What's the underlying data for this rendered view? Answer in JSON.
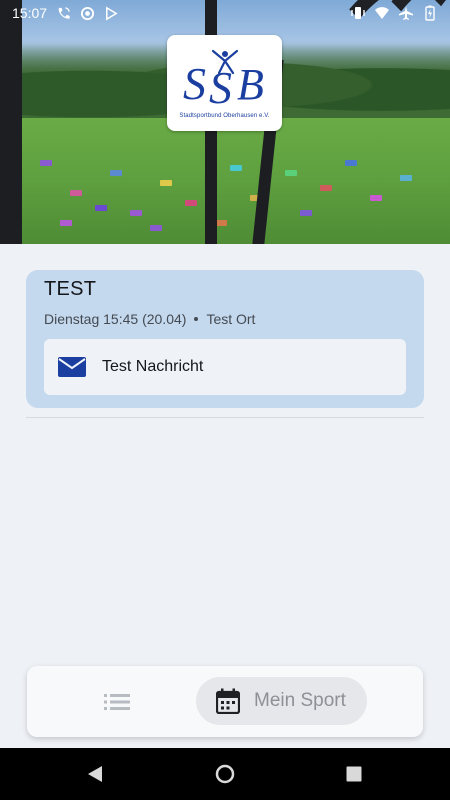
{
  "status_bar": {
    "time": "15:07",
    "left_icons": [
      "phone-wifi-icon",
      "data-saver-icon",
      "play-store-icon"
    ],
    "right_icons": [
      "vibrate-icon",
      "wifi-icon",
      "airplane-icon",
      "battery-icon"
    ]
  },
  "header": {
    "logo_caption": "Stadtsportbund Oberhausen e.V."
  },
  "event": {
    "title": "TEST",
    "datetime": "Dienstag 15:45 (20.04)",
    "location": "Test Ort",
    "message_icon": "mail-icon",
    "message": "Test Nachricht"
  },
  "bottom_nav": {
    "list_icon": "list-icon",
    "active_icon": "calendar-icon",
    "active_label": "Mein Sport"
  },
  "system_nav": {
    "buttons": [
      "back-icon",
      "home-icon",
      "recents-icon"
    ]
  },
  "colors": {
    "card_bg": "#c4d8ee",
    "accent_blue": "#1b3fa0",
    "page_bg": "#eef1f6"
  }
}
